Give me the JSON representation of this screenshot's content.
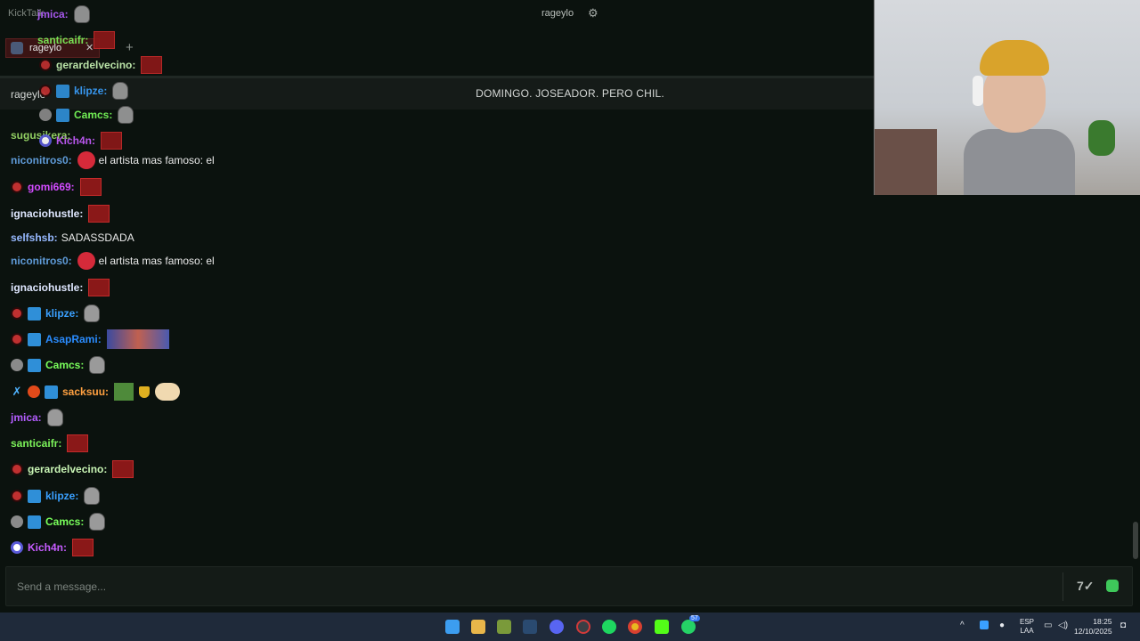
{
  "app": {
    "title": "KickTalk"
  },
  "topbar": {
    "channel": "rageylo"
  },
  "tabs": [
    {
      "label": "rageylo"
    }
  ],
  "titlebar": {
    "channel": "rageylo",
    "stream_title": "DOMINGO. JOSEADOR. PERO CHIL."
  },
  "messages": [
    {
      "user": "jmica:",
      "color": "#b45dff",
      "text": ""
    },
    {
      "user": "santicaifr:",
      "color": "#7cf25a",
      "text": ""
    },
    {
      "user": "gerardelvecino:",
      "color": "#c9f5b5",
      "text": ""
    },
    {
      "user": "klipze:",
      "color": "#3aa0ff",
      "text": ""
    },
    {
      "user": "Camcs:",
      "color": "#79ff5b",
      "text": ""
    },
    {
      "user": "Kich4n:",
      "color": "#c65cff",
      "text": ""
    },
    {
      "user": "sugusikera:",
      "color": "#9ddf6a",
      "text": ""
    },
    {
      "user": "niconitros0:",
      "color": "#5f9bd8",
      "text": "el artista mas famoso: el"
    },
    {
      "user": "gomi669:",
      "color": "#d24bff",
      "text": ""
    },
    {
      "user": "ignaciohustle:",
      "color": "#dfe7ff",
      "text": ""
    },
    {
      "user": "selfshsb:",
      "color": "#97b9ff",
      "text": "SADASSDADA"
    },
    {
      "user": "niconitros0:",
      "color": "#5f9bd8",
      "text": "el artista mas famoso: el"
    },
    {
      "user": "ignaciohustle:",
      "color": "#dfe7ff",
      "text": ""
    },
    {
      "user": "klipze:",
      "color": "#3aa0ff",
      "text": ""
    },
    {
      "user": "AsapRami:",
      "color": "#2a8cff",
      "text": ""
    },
    {
      "user": "Camcs:",
      "color": "#79ff5b",
      "text": ""
    },
    {
      "user": "sacksuu:",
      "color": "#ffa040",
      "text": ""
    },
    {
      "user": "jmica:",
      "color": "#b45dff",
      "text": ""
    },
    {
      "user": "santicaifr:",
      "color": "#7cf25a",
      "text": ""
    },
    {
      "user": "gerardelvecino:",
      "color": "#c9f5b5",
      "text": ""
    },
    {
      "user": "klipze:",
      "color": "#3aa0ff",
      "text": ""
    },
    {
      "user": "Camcs:",
      "color": "#79ff5b",
      "text": ""
    },
    {
      "user": "Kich4n:",
      "color": "#c65cff",
      "text": ""
    }
  ],
  "composer": {
    "placeholder": "Send a message..."
  },
  "taskbar": {
    "notification_count": "57",
    "lang_line1": "ESP",
    "lang_line2": "LAA",
    "time": "18:25",
    "date": "12/10/2025"
  }
}
